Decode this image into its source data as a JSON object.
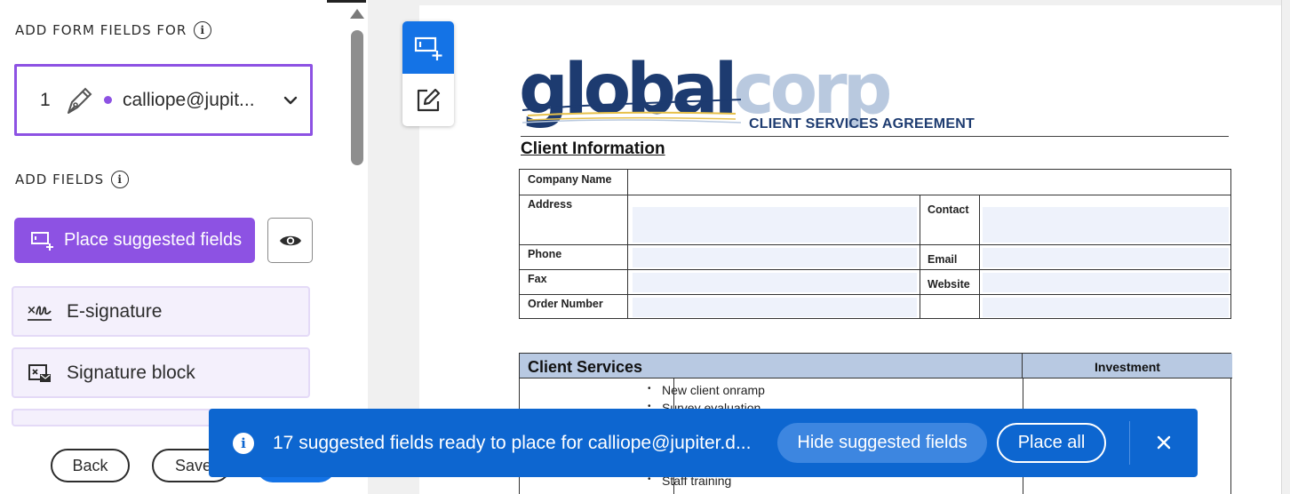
{
  "left_panel": {
    "add_form_fields_heading": "ADD FORM FIELDS FOR",
    "signer": {
      "number": "1",
      "email": "calliope@jupit..."
    },
    "add_fields_heading": "ADD FIELDS",
    "place_suggested_label": "Place suggested fields",
    "fields": [
      {
        "label": "E-signature",
        "icon": "e-signature-icon"
      },
      {
        "label": "Signature block",
        "icon": "signature-block-icon"
      }
    ],
    "back_label": "Back",
    "save_label": "Save",
    "accent_color": "#8d52e3"
  },
  "document": {
    "logo_text_dark": "global",
    "logo_text_light": "corp",
    "agreement_title": "CLIENT SERVICES AGREEMENT",
    "client_info_title": "Client Information",
    "labels": {
      "company_name": "Company Name",
      "address": "Address",
      "contact": "Contact",
      "phone": "Phone",
      "email": "Email",
      "fax": "Fax",
      "website": "Website",
      "order_number": "Order Number"
    },
    "services_title": "Client Services",
    "investment_title": "Investment",
    "services": [
      "New client onramp",
      "Survey evaluation",
      "Staff training"
    ]
  },
  "toast": {
    "message": "17 suggested fields ready to place for calliope@jupiter.d...",
    "hide_label": "Hide suggested fields",
    "place_all_label": "Place all",
    "color": "#0d66d0"
  }
}
